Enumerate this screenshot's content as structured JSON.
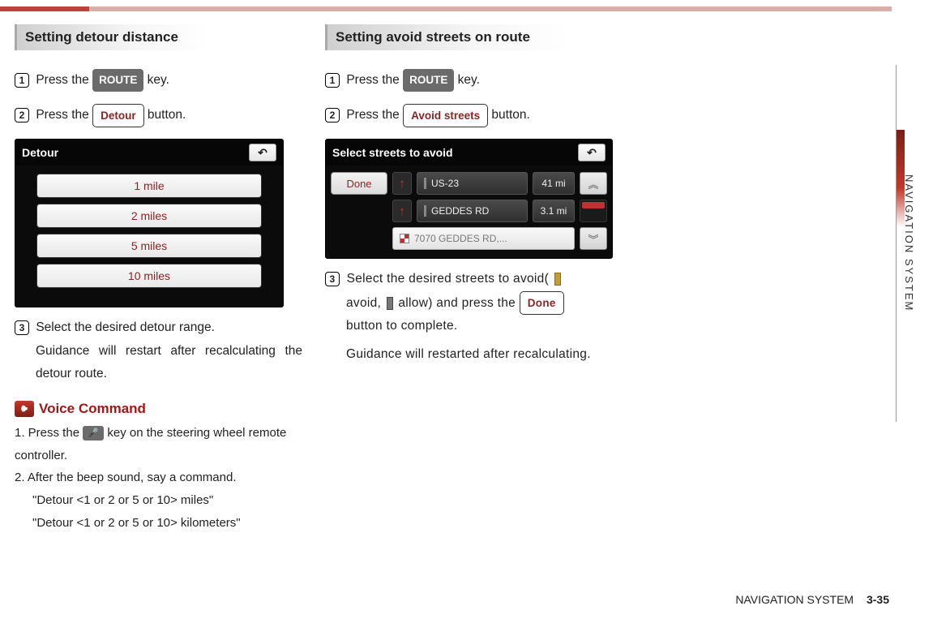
{
  "side_label": "NAVIGATION SYSTEM",
  "footer": {
    "section": "NAVIGATION SYSTEM",
    "page": "3-35"
  },
  "col1": {
    "heading": "Setting detour distance",
    "step1_a": "Press the ",
    "step1_key": "ROUTE",
    "step1_b": " key.",
    "step2_a": "Press the ",
    "step2_btn": "Detour",
    "step2_b": " button.",
    "screen_title": "Detour",
    "mile_options": [
      "1 mile",
      "2 miles",
      "5 miles",
      "10 miles"
    ],
    "step3_a": "Select the desired detour range.",
    "step3_b": "Guidance will restart after recalculating the detour route.",
    "voice_heading": "Voice Command",
    "voice_1a": "1. Press the ",
    "voice_1b": " key on the steering wheel remote controller.",
    "voice_2": "2. After the beep sound, say a command.",
    "voice_cmd1": "\"Detour <1 or 2 or 5 or 10> miles\"",
    "voice_cmd2": "\"Detour <1 or 2 or 5 or 10> kilometers\""
  },
  "col2": {
    "heading": "Setting avoid streets on route",
    "step1_a": "Press the ",
    "step1_key": "ROUTE",
    "step1_b": " key.",
    "step2_a": "Press the ",
    "step2_btn": "Avoid streets",
    "step2_b": " button.",
    "screen_title": "Select streets to avoid",
    "done_label": "Done",
    "streets": [
      {
        "name": "US-23",
        "dist": "41 mi"
      },
      {
        "name": "GEDDES RD",
        "dist": "3.1 mi"
      }
    ],
    "dest": "7070 GEDDES RD,...",
    "step3_a": "Select the desired streets to avoid(",
    "step3_b": "avoid, ",
    "step3_c": "allow) and press the ",
    "step3_btn": "Done",
    "step3_d": "button to complete.",
    "step3_e": "Guidance will  restarted after recalculating."
  }
}
